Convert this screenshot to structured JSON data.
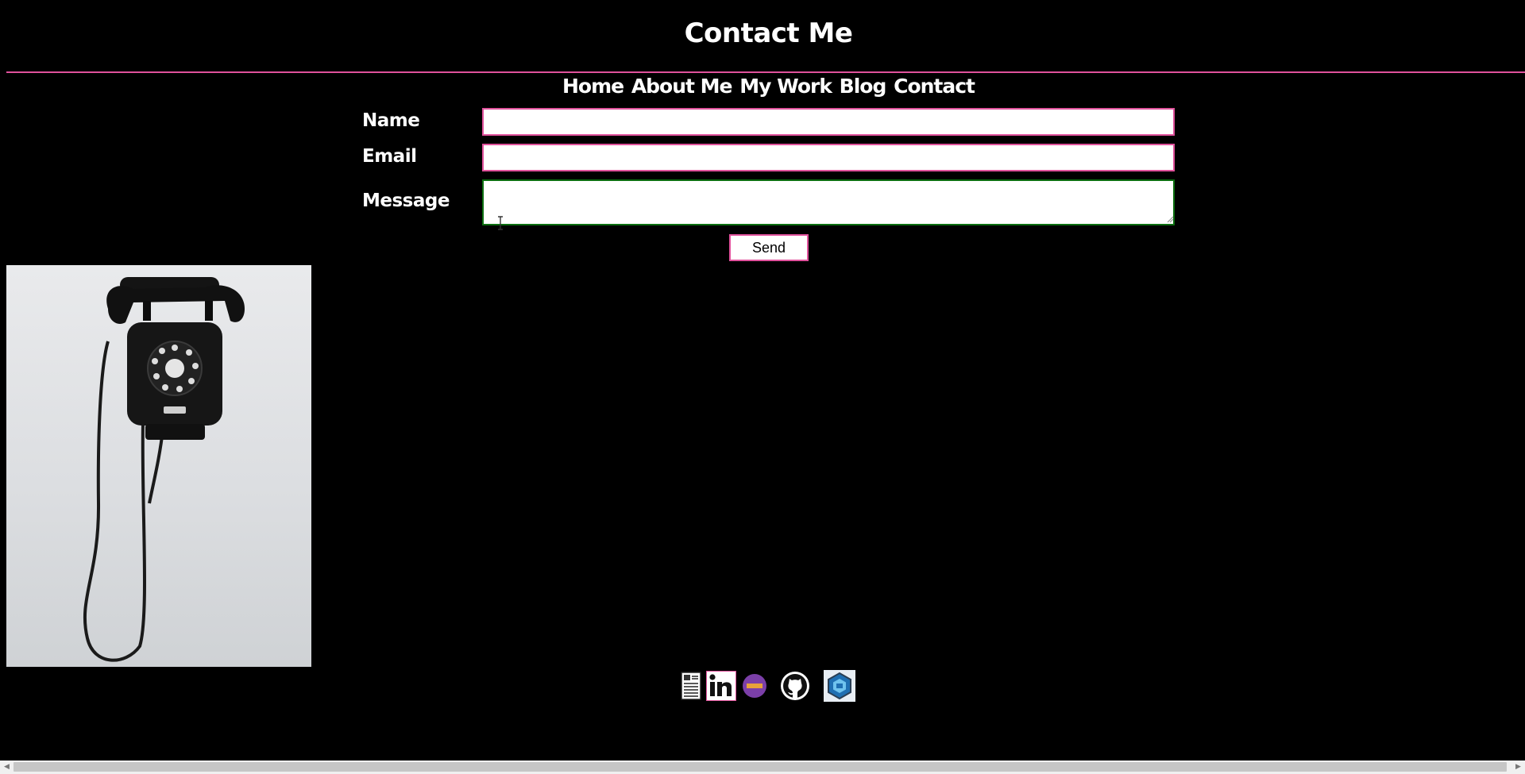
{
  "header": {
    "title": "Contact Me"
  },
  "nav": {
    "items": [
      {
        "label": "Home"
      },
      {
        "label": "About Me"
      },
      {
        "label": "My Work"
      },
      {
        "label": "Blog"
      },
      {
        "label": "Contact"
      }
    ]
  },
  "form": {
    "name_label": "Name",
    "email_label": "Email",
    "message_label": "Message",
    "name_value": "",
    "email_value": "",
    "message_value": "",
    "send_label": "Send"
  },
  "image": {
    "subject": "rotary-telephone"
  },
  "social": {
    "items": [
      {
        "icon": "resume-icon"
      },
      {
        "icon": "linkedin-icon"
      },
      {
        "icon": "dev-community-icon"
      },
      {
        "icon": "github-icon"
      },
      {
        "icon": "codewars-icon"
      }
    ]
  },
  "colors": {
    "background": "#000000",
    "accent": "#e0529c",
    "focus_border": "#0c6e10",
    "text": "#ffffff"
  }
}
